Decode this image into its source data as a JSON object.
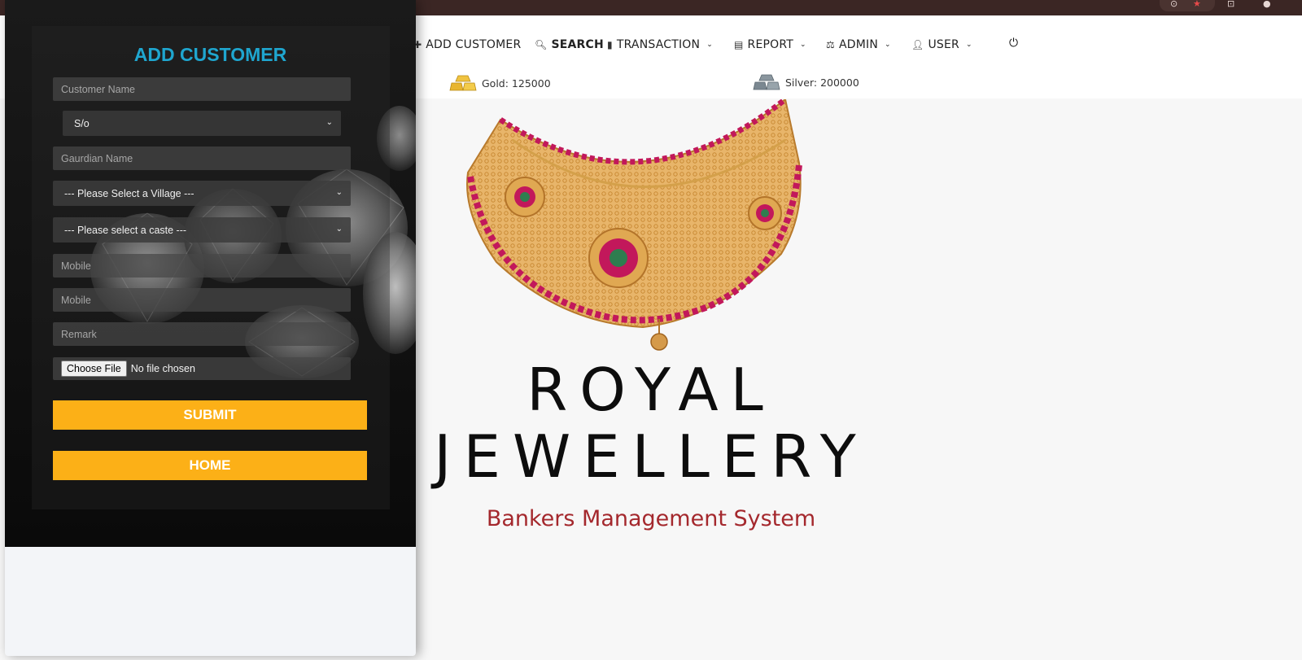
{
  "colors": {
    "accent": "#fcb017",
    "title": "#1fa6cf",
    "tagline": "#a4282d",
    "chrome": "#3b2624"
  },
  "nav": {
    "items": [
      {
        "label": "ADD CUSTOMER",
        "icon": "user-plus-icon"
      },
      {
        "label": "SEARCH",
        "icon": "search-icon"
      },
      {
        "label": "TRANSACTION",
        "icon": "bar-chart-icon"
      },
      {
        "label": "REPORT",
        "icon": "newspaper-icon"
      },
      {
        "label": "ADMIN",
        "icon": "balance-scale-icon"
      },
      {
        "label": "USER",
        "icon": "user-icon"
      }
    ],
    "logout_icon": "power-icon"
  },
  "rates": {
    "gold": "Gold: 125000",
    "silver": "Silver: 200000"
  },
  "brand": {
    "line1": "ROYAL",
    "line2": "JEWELLERY",
    "tagline": "Bankers Management System"
  },
  "form": {
    "title": "ADD CUSTOMER",
    "customer_name_placeholder": "Customer Name",
    "relation_selected": "S/o",
    "guardian_placeholder": "Gaurdian Name",
    "village_selected": "--- Please Select a Village ---",
    "caste_selected": "--- Please select a caste ---",
    "mobile1_placeholder": "Mobile",
    "mobile2_placeholder": "Mobile",
    "remark_placeholder": "Remark",
    "file_button": "Choose File",
    "file_status": "No file chosen",
    "submit_label": "SUBMIT",
    "home_label": "HOME"
  }
}
